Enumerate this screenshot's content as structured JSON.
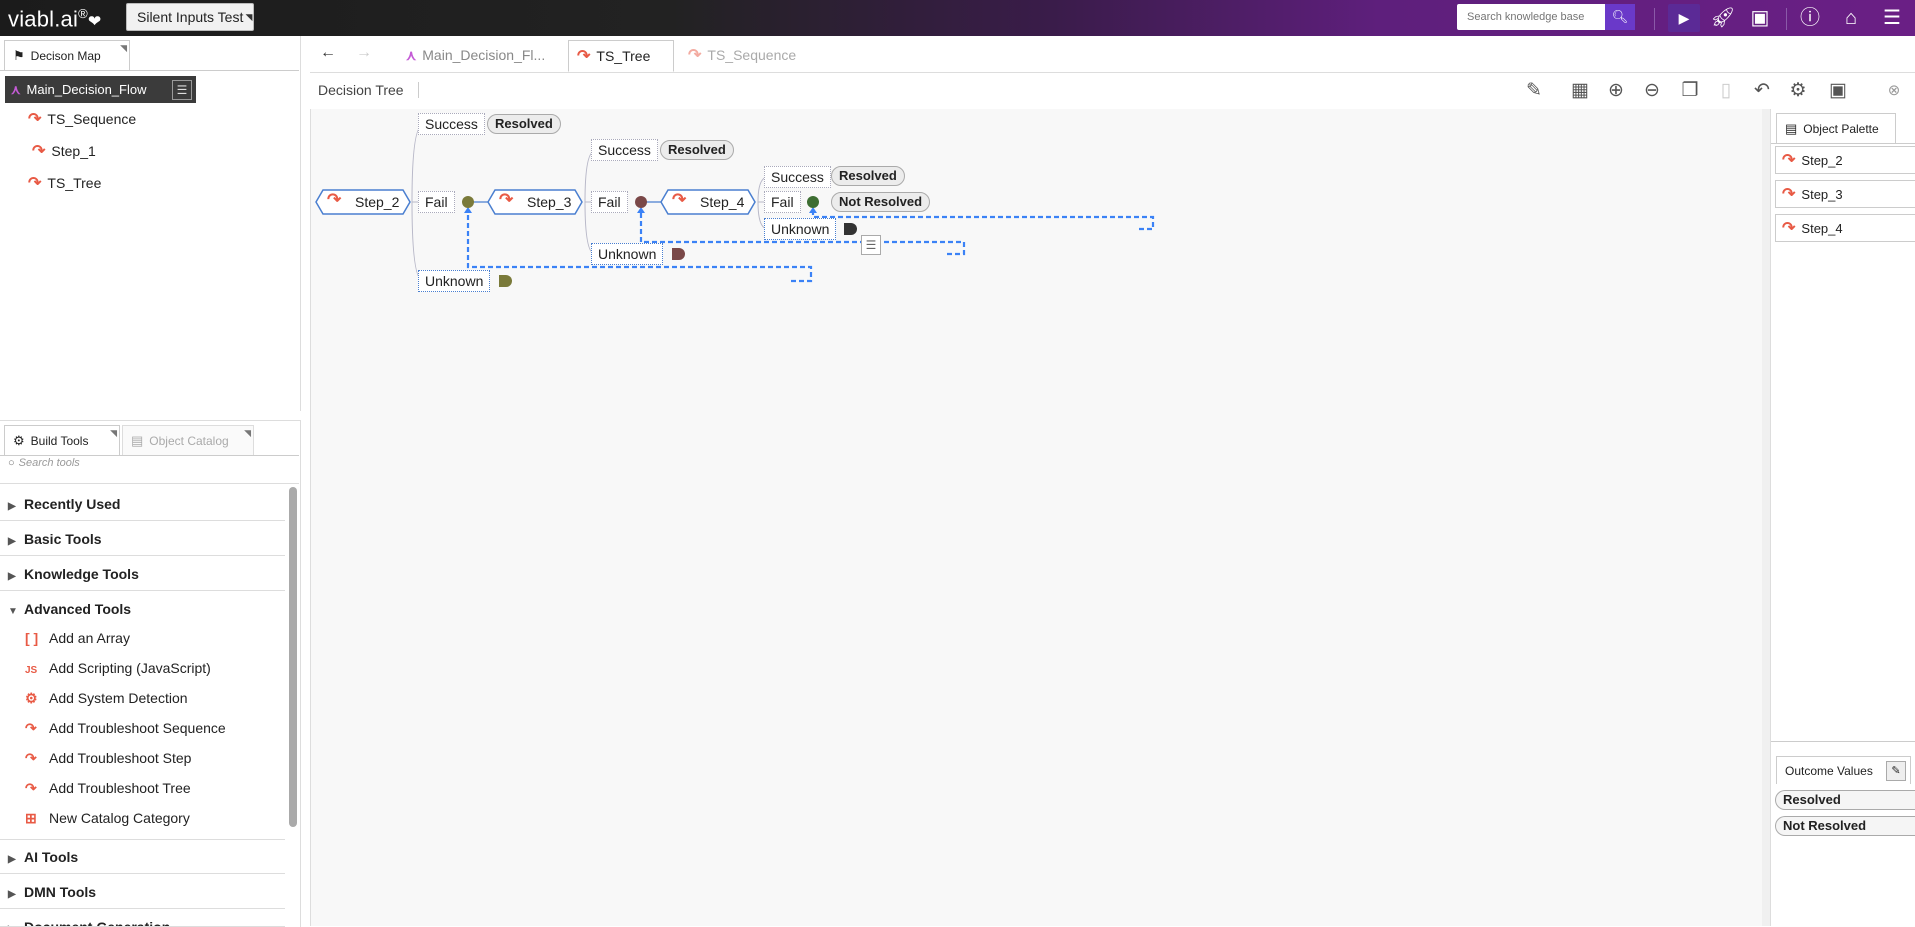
{
  "app": {
    "brand": "viabl.ai",
    "brand_mark": "®",
    "project_name": "Silent Inputs Test",
    "search_placeholder": "Search knowledge base"
  },
  "left_top_panel": {
    "tab_label": "Decison Map",
    "root": "Main_Decision_Flow",
    "items": [
      "TS_Sequence",
      "Step_1",
      "TS_Tree"
    ]
  },
  "left_bottom_panel": {
    "tabs": [
      "Build Tools",
      "Object Catalog"
    ],
    "search_placeholder": "Search tools",
    "categories": {
      "recently_used": "Recently Used",
      "basic": "Basic Tools",
      "knowledge": "Knowledge Tools",
      "advanced": "Advanced Tools",
      "ai": "AI Tools",
      "dmn": "DMN Tools",
      "document": "Document Generation"
    },
    "advanced_items": [
      "Add an Array",
      "Add Scripting (JavaScript)",
      "Add System Detection",
      "Add Troubleshoot Sequence",
      "Add Troubleshoot Step",
      "Add Troubleshoot Tree",
      "New Catalog Category"
    ]
  },
  "doc_tabs": [
    "Main_Decision_Fl...",
    "TS_Tree",
    "TS_Sequence"
  ],
  "toolbar": {
    "label": "Decision Tree"
  },
  "tree": {
    "steps": [
      "Step_2",
      "Step_3",
      "Step_4"
    ],
    "branches": {
      "success": "Success",
      "fail": "Fail",
      "unknown": "Unknown"
    },
    "outcomes": {
      "resolved": "Resolved",
      "not_resolved": "Not Resolved"
    },
    "colors": {
      "olive": "#7a7a3a",
      "maroon": "#7a4848",
      "green": "#3e6e33",
      "dark": "#333333",
      "link": "#3b82f6",
      "accent": "#e85a45"
    }
  },
  "right_panel": {
    "palette_tab": "Object Palette",
    "palette_items": [
      "Step_2",
      "Step_3",
      "Step_4"
    ],
    "outcome_values_label": "Outcome Values",
    "outcome_values": [
      "Resolved",
      "Not Resolved"
    ]
  }
}
